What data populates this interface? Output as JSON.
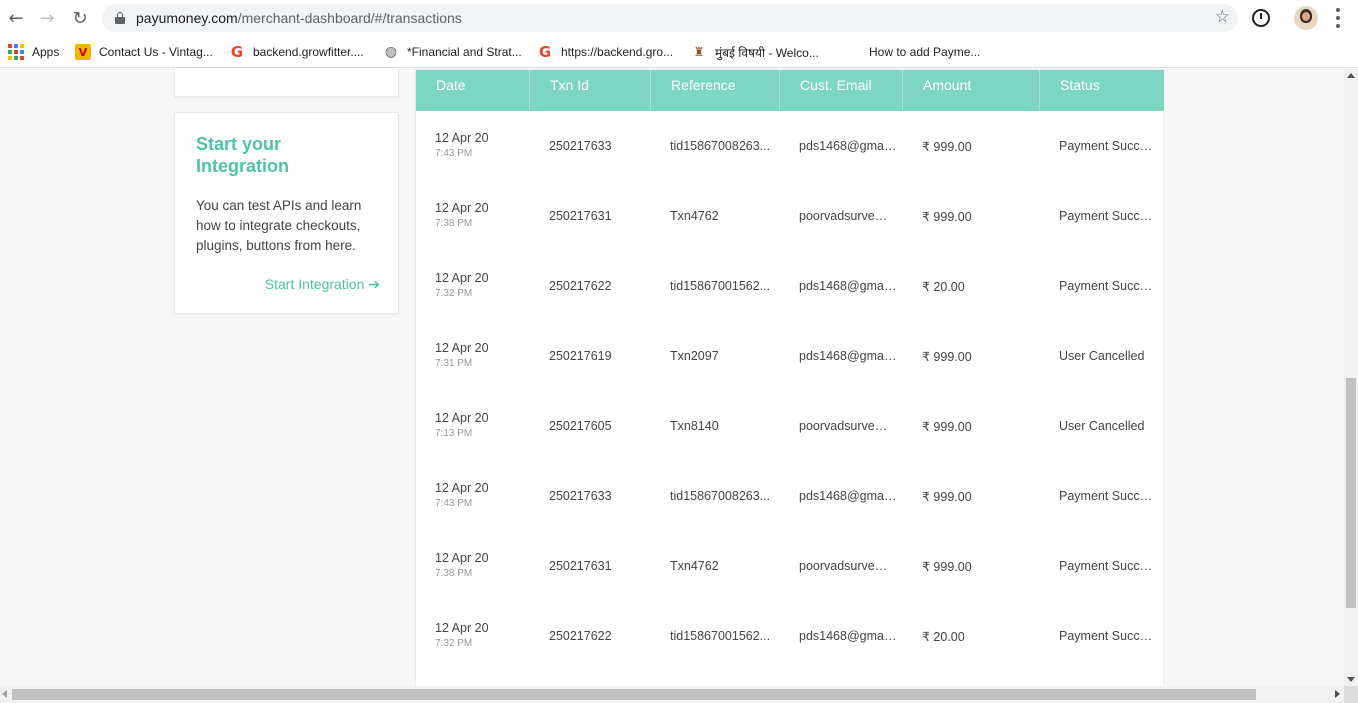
{
  "browser": {
    "url_host": "payumoney.com",
    "url_path": "/merchant-dashboard/#/transactions",
    "back_icon": "←",
    "forward_icon": "→",
    "reload_icon": "↻",
    "star_icon": "☆",
    "bookmarks": [
      {
        "label": "Apps",
        "icon": "apps-grid-icon"
      },
      {
        "label": "Contact Us - Vintag...",
        "icon": "v-icon"
      },
      {
        "label": "backend.growfitter....",
        "icon": "g-icon"
      },
      {
        "label": "*Financial and Strat...",
        "icon": "globe-icon"
      },
      {
        "label": "https://backend.gro...",
        "icon": "g-icon"
      },
      {
        "label": "मुंबई विषयी - Welco...",
        "icon": "temple-icon"
      },
      {
        "label": "How to add Payme...",
        "icon": "microsoft-icon"
      }
    ]
  },
  "integration_card": {
    "title": "Start your Integration",
    "description": "You can test APIs and learn how to integrate checkouts, plugins, buttons from here.",
    "link_label": "Start Integration ➔"
  },
  "table": {
    "header_color": "#7dd6c2",
    "columns": [
      "Date",
      "Txn Id",
      "Reference",
      "Cust. Email",
      "Amount",
      "Status"
    ],
    "rows": [
      {
        "date": "12 Apr 20",
        "time": "7:43 PM",
        "txn": "250217633",
        "ref": "tid15867008263...",
        "email": "pds1468@gmail....",
        "amount": "₹ 999.00",
        "status": "Payment Success..."
      },
      {
        "date": "12 Apr 20",
        "time": "7:38 PM",
        "txn": "250217631",
        "ref": "Txn4762",
        "email": "poorvadsurve@g...",
        "amount": "₹ 999.00",
        "status": "Payment Success..."
      },
      {
        "date": "12 Apr 20",
        "time": "7:32 PM",
        "txn": "250217622",
        "ref": "tid15867001562...",
        "email": "pds1468@gmail....",
        "amount": "₹ 20.00",
        "status": "Payment Success..."
      },
      {
        "date": "12 Apr 20",
        "time": "7:31 PM",
        "txn": "250217619",
        "ref": "Txn2097",
        "email": "pds1468@gmail....",
        "amount": "₹ 999.00",
        "status": "User Cancelled"
      },
      {
        "date": "12 Apr 20",
        "time": "7:13 PM",
        "txn": "250217605",
        "ref": "Txn8140",
        "email": "poorvadsurve@g...",
        "amount": "₹ 999.00",
        "status": "User Cancelled"
      },
      {
        "date": "12 Apr 20",
        "time": "7:43 PM",
        "txn": "250217633",
        "ref": "tid15867008263...",
        "email": "pds1468@gmail....",
        "amount": "₹ 999.00",
        "status": "Payment Success..."
      },
      {
        "date": "12 Apr 20",
        "time": "7:38 PM",
        "txn": "250217631",
        "ref": "Txn4762",
        "email": "poorvadsurve@g...",
        "amount": "₹ 999.00",
        "status": "Payment Success..."
      },
      {
        "date": "12 Apr 20",
        "time": "7:32 PM",
        "txn": "250217622",
        "ref": "tid15867001562...",
        "email": "pds1468@gmail....",
        "amount": "₹ 20.00",
        "status": "Payment Success..."
      }
    ]
  }
}
